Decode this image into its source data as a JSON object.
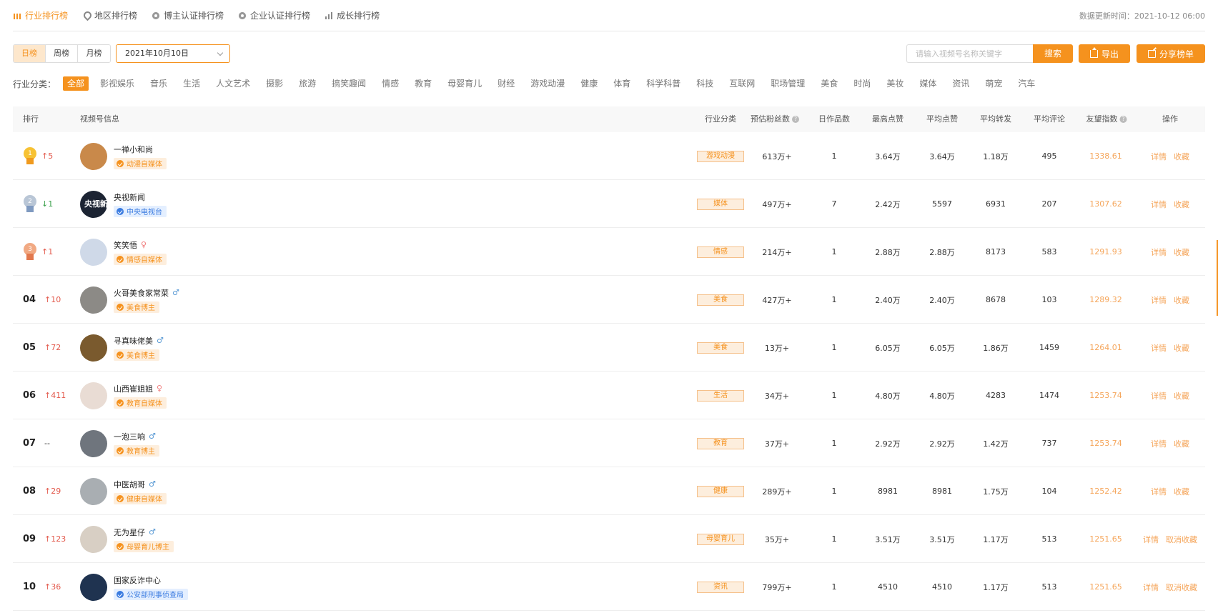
{
  "nav": {
    "tabs": [
      {
        "label": "行业排行榜",
        "icon": "bar-chart-icon",
        "active": true
      },
      {
        "label": "地区排行榜",
        "icon": "location-pin-icon"
      },
      {
        "label": "博主认证排行榜",
        "icon": "badge-icon"
      },
      {
        "label": "企业认证排行榜",
        "icon": "badge-icon"
      },
      {
        "label": "成长排行榜",
        "icon": "growth-chart-icon"
      }
    ],
    "update_time": "数据更新时间：2021-10-12 06:00"
  },
  "filters": {
    "periods": [
      "日榜",
      "周榜",
      "月榜"
    ],
    "active_period": "日榜",
    "date": "2021年10月10日",
    "search_placeholder": "请输入视频号名称关键字",
    "search_label": "搜索",
    "export_label": "导出",
    "share_label": "分享榜单"
  },
  "categories": {
    "label": "行业分类：",
    "items": [
      "全部",
      "影视娱乐",
      "音乐",
      "生活",
      "人文艺术",
      "摄影",
      "旅游",
      "搞笑趣闻",
      "情感",
      "教育",
      "母婴育儿",
      "财经",
      "游戏动漫",
      "健康",
      "体育",
      "科学科普",
      "科技",
      "互联网",
      "职场管理",
      "美食",
      "时尚",
      "美妆",
      "媒体",
      "资讯",
      "萌宠",
      "汽车"
    ],
    "active": "全部"
  },
  "table": {
    "headers": {
      "rank": "排行",
      "info": "视频号信息",
      "industry": "行业分类",
      "fans": "预估粉丝数",
      "daily_works": "日作品数",
      "max_likes": "最高点赞",
      "avg_likes": "平均点赞",
      "avg_shares": "平均转发",
      "avg_comments": "平均评论",
      "index": "友望指数",
      "actions": "操作"
    },
    "rows": [
      {
        "rank": "1",
        "medal": "gold",
        "trend": "5",
        "trend_dir": "up",
        "name": "一禅小和尚",
        "gender": "",
        "badge": "动漫自媒体",
        "badge_type": "orange",
        "industry": "游戏动漫",
        "fans": "613万+",
        "daily_works": "1",
        "max_likes": "3.64万",
        "avg_likes": "3.64万",
        "avg_shares": "1.18万",
        "avg_comments": "495",
        "index": "1338.61",
        "detail": "详情",
        "fav": "收藏",
        "avatar": "#c9894a"
      },
      {
        "rank": "2",
        "medal": "silver",
        "trend": "1",
        "trend_dir": "down",
        "name": "央视新闻",
        "gender": "",
        "badge": "中央电视台",
        "badge_type": "blue",
        "industry": "媒体",
        "fans": "497万+",
        "daily_works": "7",
        "max_likes": "2.42万",
        "avg_likes": "5597",
        "avg_shares": "6931",
        "avg_comments": "207",
        "index": "1307.62",
        "detail": "详情",
        "fav": "收藏",
        "avatar": "cctv",
        "avatar_text": "央视新闻"
      },
      {
        "rank": "3",
        "medal": "bronze",
        "trend": "1",
        "trend_dir": "up",
        "name": "笑笑悟",
        "gender": "♀",
        "badge": "情感自媒体",
        "badge_type": "orange",
        "industry": "情感",
        "fans": "214万+",
        "daily_works": "1",
        "max_likes": "2.88万",
        "avg_likes": "2.88万",
        "avg_shares": "8173",
        "avg_comments": "583",
        "index": "1291.93",
        "detail": "详情",
        "fav": "收藏",
        "avatar": "#cfd9e8"
      },
      {
        "rank": "04",
        "medal": "",
        "trend": "10",
        "trend_dir": "up",
        "name": "火哥美食家常菜",
        "gender": "♂",
        "badge": "美食博主",
        "badge_type": "orange",
        "industry": "美食",
        "fans": "427万+",
        "daily_works": "1",
        "max_likes": "2.40万",
        "avg_likes": "2.40万",
        "avg_shares": "8678",
        "avg_comments": "103",
        "index": "1289.32",
        "detail": "详情",
        "fav": "收藏",
        "avatar": "#8c8a86"
      },
      {
        "rank": "05",
        "medal": "",
        "trend": "72",
        "trend_dir": "up",
        "name": "寻真味佬美",
        "gender": "♂",
        "badge": "美食博主",
        "badge_type": "orange",
        "industry": "美食",
        "fans": "13万+",
        "daily_works": "1",
        "max_likes": "6.05万",
        "avg_likes": "6.05万",
        "avg_shares": "1.86万",
        "avg_comments": "1459",
        "index": "1264.01",
        "detail": "详情",
        "fav": "收藏",
        "avatar": "#7a5a2e"
      },
      {
        "rank": "06",
        "medal": "",
        "trend": "411",
        "trend_dir": "up",
        "name": "山西崔姐姐",
        "gender": "♀",
        "badge": "教育自媒体",
        "badge_type": "orange",
        "industry": "生活",
        "fans": "34万+",
        "daily_works": "1",
        "max_likes": "4.80万",
        "avg_likes": "4.80万",
        "avg_shares": "4283",
        "avg_comments": "1474",
        "index": "1253.74",
        "detail": "详情",
        "fav": "收藏",
        "avatar": "#e9dcd4"
      },
      {
        "rank": "07",
        "medal": "",
        "trend": "--",
        "trend_dir": "flat",
        "name": "一泡三响",
        "gender": "♂",
        "badge": "教育博主",
        "badge_type": "orange",
        "industry": "教育",
        "fans": "37万+",
        "daily_works": "1",
        "max_likes": "2.92万",
        "avg_likes": "2.92万",
        "avg_shares": "1.42万",
        "avg_comments": "737",
        "index": "1253.74",
        "detail": "详情",
        "fav": "收藏",
        "avatar": "#6f757d"
      },
      {
        "rank": "08",
        "medal": "",
        "trend": "29",
        "trend_dir": "up",
        "name": "中医胡哥",
        "gender": "♂",
        "badge": "健康自媒体",
        "badge_type": "orange",
        "industry": "健康",
        "fans": "289万+",
        "daily_works": "1",
        "max_likes": "8981",
        "avg_likes": "8981",
        "avg_shares": "1.75万",
        "avg_comments": "104",
        "index": "1252.42",
        "detail": "详情",
        "fav": "收藏",
        "avatar": "#a9aeb2"
      },
      {
        "rank": "09",
        "medal": "",
        "trend": "123",
        "trend_dir": "up",
        "name": "无为星仔",
        "gender": "♂",
        "badge": "母婴育儿博主",
        "badge_type": "orange",
        "industry": "母婴育儿",
        "fans": "35万+",
        "daily_works": "1",
        "max_likes": "3.51万",
        "avg_likes": "3.51万",
        "avg_shares": "1.17万",
        "avg_comments": "513",
        "index": "1251.65",
        "detail": "详情",
        "fav": "取消收藏",
        "avatar": "#d8cfc4"
      },
      {
        "rank": "10",
        "medal": "",
        "trend": "36",
        "trend_dir": "up",
        "name": "国家反诈中心",
        "gender": "",
        "badge": "公安部刑事侦查局",
        "badge_type": "blue",
        "industry": "资讯",
        "fans": "799万+",
        "daily_works": "1",
        "max_likes": "4510",
        "avg_likes": "4510",
        "avg_shares": "1.17万",
        "avg_comments": "513",
        "index": "1251.65",
        "detail": "详情",
        "fav": "取消收藏",
        "avatar": "#1f3350"
      }
    ]
  }
}
